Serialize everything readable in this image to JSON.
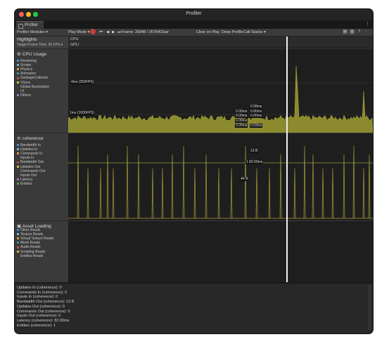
{
  "window": {
    "title": "Profiler",
    "tab": "Profiler"
  },
  "toolbar": {
    "modules": "Profiler Modules",
    "play_mode": "Play Mode",
    "frame": "Frame: 26848 / 26764",
    "clear": "Clear",
    "clear_on_play": "Clear on Play",
    "deep_profile": "Deep Profile",
    "call_stacks": "Call Stacks"
  },
  "highlights": {
    "title": "Highlights",
    "target": "Target Frame Time: 60 FPS"
  },
  "strips": {
    "cpu": "CPU",
    "gpu": "GPU"
  },
  "cpu": {
    "title": "CPU Usage",
    "items": [
      {
        "label": "Rendering",
        "color": "#4c8fd1"
      },
      {
        "label": "Scripts",
        "color": "#7ab7d8"
      },
      {
        "label": "Physics",
        "color": "#d89a3a"
      },
      {
        "label": "Animation",
        "color": "#3a9b8e"
      },
      {
        "label": "GarbageCollector",
        "color": "#c04c4c"
      },
      {
        "label": "VSync",
        "color": "#c8c23c"
      },
      {
        "label": "Global Illumination",
        "color": ""
      },
      {
        "label": "UI",
        "color": ""
      },
      {
        "label": "Others",
        "color": "#9b7ab8"
      }
    ],
    "label_4ms": "4ms (250FPS)",
    "label_1ms": "1ms (1000FPS)",
    "vals": [
      "0.08ms",
      "0.00ms",
      "0.00ms",
      "0.00ms",
      "0.00ms",
      "0.00ms",
      "3.05ms",
      "0.03ms"
    ]
  },
  "coherence": {
    "title": "coherence",
    "items": [
      {
        "label": "Bandwidth In",
        "color": "#4c8fd1"
      },
      {
        "label": "Updates In",
        "color": "#7ab7d8"
      },
      {
        "label": "Commands In",
        "color": "#d89a3a"
      },
      {
        "label": "Inputs In",
        "color": ""
      },
      {
        "label": "Bandwidth Out",
        "color": "#c04c4c"
      },
      {
        "label": "Updates Out",
        "color": "#c8c23c"
      },
      {
        "label": "Commands Out",
        "color": ""
      },
      {
        "label": "Inputs Out",
        "color": ""
      },
      {
        "label": "Latency",
        "color": "#9b7ab8"
      },
      {
        "label": "Entities",
        "color": "#5fa05f"
      }
    ],
    "val_a": "13 B",
    "val_b": "1 82.00ms",
    "val_c": "44 B"
  },
  "asset": {
    "title": "Asset Loading",
    "items": [
      {
        "label": "Other Reads",
        "color": "#4c8fd1"
      },
      {
        "label": "Texture Reads",
        "color": "#7ab7d8"
      },
      {
        "label": "Virtual Texture Reads",
        "color": "#d89a3a"
      },
      {
        "label": "Mesh Reads",
        "color": "#3a9b8e"
      },
      {
        "label": "Audio Reads",
        "color": "#c04c4c"
      },
      {
        "label": "Scripting Reads",
        "color": "#c8c23c"
      },
      {
        "label": "Entities Reads",
        "color": ""
      }
    ]
  },
  "details": [
    "Updates In (coherence): 0",
    "Commands In (coherence): 0",
    "Inputs In (coherence): 0",
    "Bandwidth Out (coherence): 13 B",
    "Updates Out (coherence): 0",
    "Commands Out (coherence): 0",
    "Inputs Out (coherence): 0",
    "Latency (coherence): 82.00ms",
    "Entities (coherence): 1"
  ]
}
